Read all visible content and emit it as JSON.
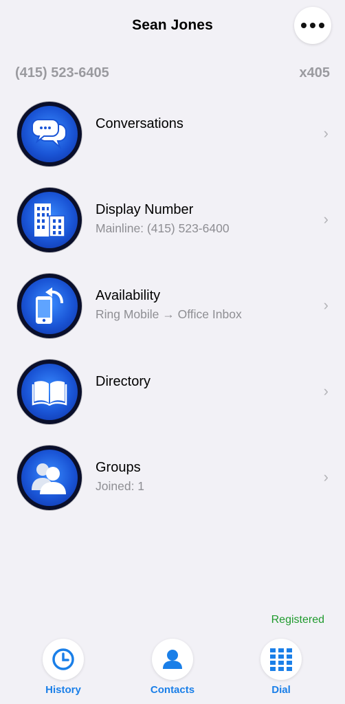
{
  "header": {
    "title": "Sean Jones",
    "more_icon": "ellipsis-icon"
  },
  "account": {
    "phone": "(415) 523-6405",
    "extension": "x405"
  },
  "menu": [
    {
      "label": "Conversations",
      "sub": "",
      "icon": "chat-bubbles-icon"
    },
    {
      "label": "Display Number",
      "sub": "Mainline: (415) 523-6400",
      "icon": "building-icon"
    },
    {
      "label": "Availability",
      "sub": "Ring Mobile → Office Inbox",
      "icon": "phone-forward-icon"
    },
    {
      "label": "Directory",
      "sub": "",
      "icon": "book-icon"
    },
    {
      "label": "Groups",
      "sub": "Joined: 1",
      "icon": "users-icon"
    }
  ],
  "status": {
    "text": "Registered",
    "color": "#1f9a2d"
  },
  "tabs": [
    {
      "label": "History",
      "icon": "clock-icon"
    },
    {
      "label": "Contacts",
      "icon": "person-icon"
    },
    {
      "label": "Dial",
      "icon": "keypad-icon"
    }
  ],
  "colors": {
    "accent": "#1a7fe8",
    "background": "#f2f1f6",
    "icon_blue": "#1a55d6"
  }
}
